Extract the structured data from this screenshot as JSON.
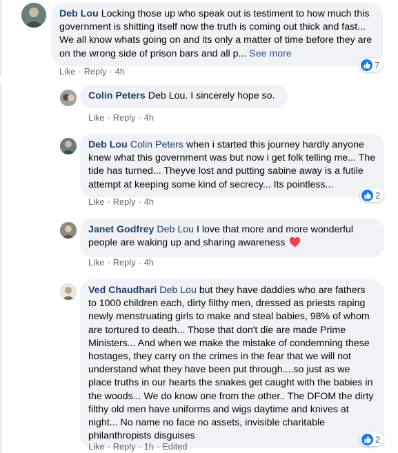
{
  "colors": {
    "bubble": "#f0f2f5",
    "author": "#1c3f68",
    "meta": "#65676b",
    "link": "#385898",
    "like": "#1877f2",
    "heart": "#f33e58"
  },
  "comments": [
    {
      "author": "Deb Lou",
      "text": "Locking those up who speak out is testiment to how much this government is shitting itself now the truth is coming out thick and fast... We all know whats going on and its only a matter of time before they are on the wrong side of prison bars and all p...",
      "see_more": "See more",
      "like": "Like",
      "reply": "Reply",
      "time": "4h",
      "reactions": "7",
      "reaction_icon": "like-icon"
    },
    {
      "author": "Colin Peters",
      "text": "Deb Lou. I sincerely hope so.",
      "like": "Like",
      "reply": "Reply",
      "time": "4h"
    },
    {
      "author": "Deb Lou",
      "tag": "Colin Peters",
      "text": "when i started this journey hardly anyone knew what this government was but now i get folk telling me... The tide has turned... Theyve lost and putting sabine away is a futile attempt at keeping some kind of secrecy... Its pointless...",
      "like": "Like",
      "reply": "Reply",
      "time": "4h",
      "reactions": "2",
      "reaction_icon": "like-icon"
    },
    {
      "author": "Janet Godfrey",
      "tag": "Deb Lou",
      "text": "I love that more and more wonderful people are waking up and sharing awareness",
      "emoji": "heart-icon",
      "like": "Like",
      "reply": "Reply",
      "time": "4h"
    },
    {
      "author": "Ved Chaudhari",
      "tag": "Deb Lou",
      "text": "but they have daddies who are fathers to 1000 children each, dirty filthy men, dressed as priests raping newly menstruating girls to make and steal babies, 98% of whom are tortured to death... Those that don't die are made Prime Ministers... And when we make the mistake of condemning these hostages, they carry on the crimes in the fear that we will not understand what they have been put through....so just as we place truths in our hearts the snakes get caught with the babies in the woods... We do know one from the other.. The DFOM the dirty filthy old men have uniforms and wigs daytime and knives at night... No name no face no assets, invisible charitable philanthropists disguises",
      "like": "Like",
      "reply": "Reply",
      "time": "1h",
      "edited": "Edited",
      "reactions": "2",
      "reaction_icon": "like-icon"
    }
  ]
}
